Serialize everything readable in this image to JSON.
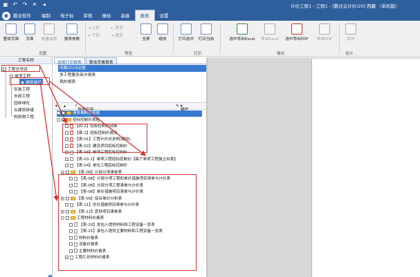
{
  "app": {
    "title": "计价工程1 - 工程1 - [鹏业云计价i20] 西藏 （单机版）",
    "brand": "鹏业软件",
    "menu_tabs": [
      "编制",
      "电子标",
      "审核",
      "报标",
      "高级",
      "报表",
      "设置"
    ],
    "active_tab": "报表"
  },
  "ribbon": {
    "buttons": [
      {
        "label": "整体页面",
        "enabled": true
      },
      {
        "label": "页面",
        "enabled": true
      },
      {
        "label": "批量选择",
        "enabled": false
      },
      {
        "label": "报表参数",
        "enabled": true
      },
      {
        "label": "上页",
        "enabled": false
      },
      {
        "label": "下页",
        "enabled": false
      },
      {
        "label": "首页",
        "enabled": false
      },
      {
        "label": "尾页",
        "enabled": false
      },
      {
        "label": "全屏",
        "enabled": true
      },
      {
        "label": "缩放",
        "enabled": true
      },
      {
        "label": "打印选中",
        "enabled": true
      },
      {
        "label": "打印当前",
        "enabled": true
      },
      {
        "label": "选中导出Excel",
        "enabled": true
      },
      {
        "label": "导出Excel",
        "enabled": false
      },
      {
        "label": "选中导出PDF",
        "enabled": true
      },
      {
        "label": "导出PDF",
        "enabled": false
      },
      {
        "label": "设计",
        "enabled": false
      }
    ],
    "groups": [
      "设置",
      "预览",
      "打印",
      "输出",
      "设计"
    ]
  },
  "left_tree": {
    "header": "工程名称",
    "items": [
      {
        "label": "工程总项目",
        "selected": false
      },
      {
        "label": "单项工程",
        "selected": false
      },
      {
        "label": "建筑装饰",
        "selected": true
      },
      {
        "label": "安装工程",
        "selected": false
      },
      {
        "label": "市政工程",
        "selected": false
      },
      {
        "label": "园林绿化",
        "selected": false
      },
      {
        "label": "古建筑修缮",
        "selected": false
      },
      {
        "label": "构筑物工程",
        "selected": false
      }
    ]
  },
  "middle": {
    "tabs": [
      "选择打印报表",
      "整体查看报表"
    ],
    "active_tab": "选择打印报表",
    "top_list": [
      {
        "label": "西藏2016定额",
        "selected": true
      },
      {
        "label": "多工程量及审计报表",
        "selected": false
      },
      {
        "label": "我的报表",
        "selected": false
      }
    ],
    "toolbar": {
      "quick_label": "快速应用",
      "maintain_label": "维护"
    },
    "reports": [
      {
        "label": "清单编制报表格",
        "type": "folder-selected",
        "indent": 0
      },
      {
        "label": "招标控制价表格",
        "type": "folder",
        "indent": 0
      },
      {
        "label": "【封-2】招标控制价封面",
        "type": "report",
        "indent": 2
      },
      {
        "label": "【扉-2】招标控制价扉页",
        "type": "report",
        "indent": 2
      },
      {
        "label": "【表-01】工程计价总说明(横向)",
        "type": "report",
        "indent": 2
      },
      {
        "label": "【表-02】建设项目招标控制价",
        "type": "report",
        "indent": 2
      },
      {
        "label": "【表-03】单项工程招标控制价",
        "type": "report",
        "indent": 2
      },
      {
        "label": "【表-03-1】单项工程招标控制价【每个单项工程独立出表】",
        "type": "report",
        "indent": 2
      },
      {
        "label": "【表-04】单位工程招标控制价",
        "type": "report",
        "indent": 2
      },
      {
        "label": "【表-08】分部分项清单表",
        "type": "group",
        "indent": 1
      },
      {
        "label": "【表-08】分部分项工程和单价措施项目清单与计价表",
        "type": "report",
        "indent": 3
      },
      {
        "label": "【表-08】分部分项工程清单与计价表",
        "type": "report",
        "indent": 3
      },
      {
        "label": "【表-08】单价措施项目清单与计价表",
        "type": "report",
        "indent": 3
      },
      {
        "label": "【表-09】综合单价分析表",
        "type": "group",
        "indent": 1
      },
      {
        "label": "【表-11】总价措施项目清单与计价表",
        "type": "report",
        "indent": 2
      },
      {
        "label": "【表-12】其他项目清单表",
        "type": "group",
        "indent": 1
      },
      {
        "label": "工程材料价格表",
        "type": "group-open",
        "indent": 1
      },
      {
        "label": "【表-20】发包人提供材料和工程设备一览表",
        "type": "report",
        "indent": 3
      },
      {
        "label": "【表-21】承包人提供主要材料和工程设备一览表",
        "type": "report",
        "indent": 3
      },
      {
        "label": "材料价格表",
        "type": "report",
        "indent": 3
      },
      {
        "label": "设备价格表",
        "type": "report",
        "indent": 3
      },
      {
        "label": "主要材料价格表",
        "type": "report",
        "indent": 3
      },
      {
        "label": "工程汇总材料价格表",
        "type": "report",
        "indent": 2
      }
    ]
  },
  "colors": {
    "title_bg": "#2f5e9c",
    "selection": "#3579d0",
    "highlight": "#d43030"
  }
}
